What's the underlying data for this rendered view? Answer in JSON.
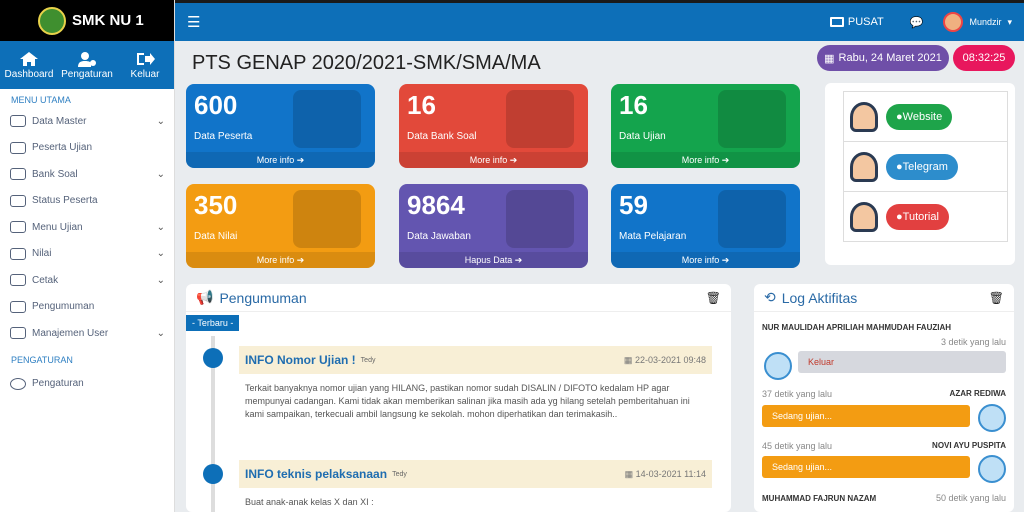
{
  "brand": {
    "name": "SMK NU 1"
  },
  "topnav": [
    {
      "label": "Dashboard"
    },
    {
      "label": "Pengaturan"
    },
    {
      "label": "Keluar"
    }
  ],
  "sidebar": {
    "section1": "MENU UTAMA",
    "items": [
      {
        "label": "Data Master",
        "chev": "⌄"
      },
      {
        "label": "Peserta Ujian",
        "chev": ""
      },
      {
        "label": "Bank Soal",
        "chev": "⌄"
      },
      {
        "label": "Status Peserta",
        "chev": ""
      },
      {
        "label": "Menu Ujian",
        "chev": "⌄"
      },
      {
        "label": "Nilai",
        "chev": "⌄"
      },
      {
        "label": "Cetak",
        "chev": "⌄"
      },
      {
        "label": "Pengumuman",
        "chev": ""
      },
      {
        "label": "Manajemen User",
        "chev": "⌄"
      }
    ],
    "section2": "PENGATURAN",
    "items2": [
      {
        "label": "Pengaturan"
      }
    ]
  },
  "topbar": {
    "pusat": "PUSAT",
    "user": "Mundzir"
  },
  "page": {
    "title": "PTS GENAP 2020/2021-SMK/SMA/MA",
    "date": "Rabu, 24 Maret 2021",
    "time": "08:32:25"
  },
  "stats": [
    {
      "num": "600",
      "label": "Data Peserta",
      "more": "More info",
      "color": "#1174c9"
    },
    {
      "num": "16",
      "label": "Data Bank Soal",
      "more": "More info",
      "color": "#e2493a"
    },
    {
      "num": "16",
      "label": "Data Ujian",
      "more": "More info",
      "color": "#14a44d"
    },
    {
      "num": "350",
      "label": "Data Nilai",
      "more": "More info",
      "color": "#f39c12"
    },
    {
      "num": "9864",
      "label": "Data Jawaban",
      "more": "Hapus Data",
      "color": "#6355b0"
    },
    {
      "num": "59",
      "label": "Mata Pelajaran",
      "more": "More info",
      "color": "#1174c9"
    }
  ],
  "links": [
    {
      "label": "Website",
      "color": "#1ea44a",
      "icon": "globe-icon"
    },
    {
      "label": "Telegram",
      "color": "#2d8dcc",
      "icon": "telegram-icon"
    },
    {
      "label": "Tutorial",
      "color": "#e24040",
      "icon": "youtube-icon"
    }
  ],
  "pengumuman": {
    "title": "Pengumuman",
    "tag": "- Terbaru -",
    "items": [
      {
        "title": "INFO Nomor Ujian !",
        "author": "Tedy",
        "date": "22-03-2021  09:48",
        "body": "Terkait banyaknya nomor ujian yang HILANG, pastikan nomor sudah DISALIN / DIFOTO kedalam HP agar mempunyai cadangan. Kami tidak akan memberikan salinan jika masih ada yg hilang setelah pemberitahuan ini kami sampaikan, terkecuali ambil langsung ke sekolah. mohon diperhatikan dan terimakasih.."
      },
      {
        "title": "INFO teknis pelaksanaan",
        "author": "Tedy",
        "date": "14-03-2021  11:14",
        "body": "Buat anak-anak kelas X dan XI :"
      }
    ]
  },
  "log": {
    "title": "Log Aktifitas",
    "items": [
      {
        "name": "NUR MAULIDAH APRILIAH MAHMUDAH FAUZIAH",
        "time": "3 detik yang lalu",
        "status": "Keluar"
      },
      {
        "name": "AZAR REDIWA",
        "time": "37 detik yang lalu",
        "status": "Sedang ujian..."
      },
      {
        "name": "NOVI AYU PUSPITA",
        "time": "45 detik yang lalu",
        "status": "Sedang ujian..."
      },
      {
        "name": "MUHAMMAD FAJRUN NAZAM",
        "time": "50 detik yang lalu",
        "status": ""
      }
    ]
  }
}
